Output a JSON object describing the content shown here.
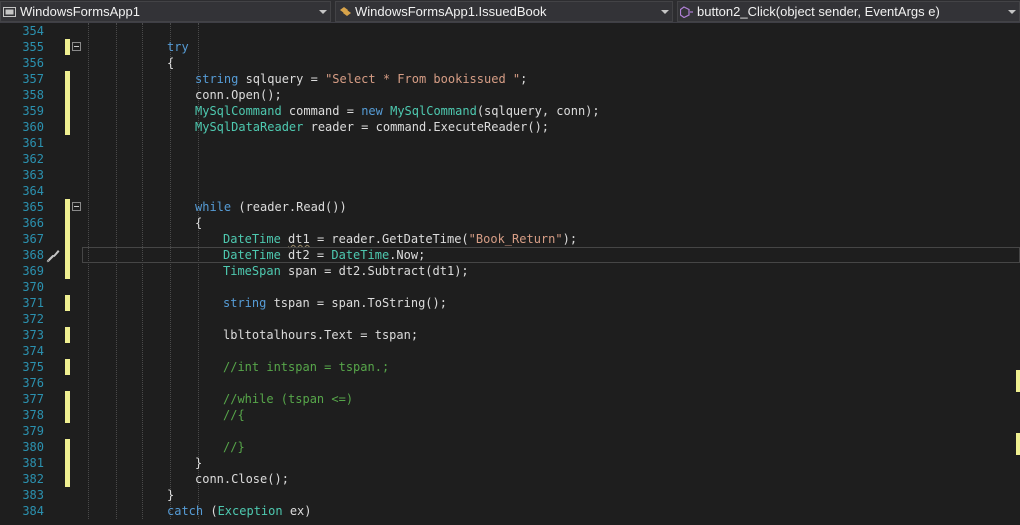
{
  "navbar": {
    "project": "WindowsFormsApp1",
    "class": "WindowsFormsApp1.IssuedBook",
    "member": "button2_Click(object sender, EventArgs e)"
  },
  "colors": {
    "background": "#1e1e1e",
    "line_number": "#2b91af",
    "keyword": "#569cd6",
    "type": "#4ec9b0",
    "string": "#d69d85",
    "comment": "#57a64a",
    "change_marker": "#efef91"
  },
  "editor": {
    "current_line": 368,
    "lines": [
      {
        "n": "354",
        "indent": 0,
        "changed": false,
        "fold": false,
        "tokens": []
      },
      {
        "n": "355",
        "indent": 2,
        "changed": true,
        "fold": true,
        "tokens": [
          {
            "k": "kw",
            "t": "try"
          }
        ]
      },
      {
        "n": "356",
        "indent": 2,
        "changed": false,
        "fold": false,
        "tokens": [
          {
            "k": "p",
            "t": "{"
          }
        ]
      },
      {
        "n": "357",
        "indent": 3,
        "changed": true,
        "fold": false,
        "tokens": [
          {
            "k": "kw",
            "t": "string"
          },
          {
            "k": "p",
            "t": " sqlquery = "
          },
          {
            "k": "str",
            "t": "\"Select * From bookissued \""
          },
          {
            "k": "p",
            "t": ";"
          }
        ]
      },
      {
        "n": "358",
        "indent": 3,
        "changed": true,
        "fold": false,
        "tokens": [
          {
            "k": "p",
            "t": "conn.Open();"
          }
        ]
      },
      {
        "n": "359",
        "indent": 3,
        "changed": true,
        "fold": false,
        "tokens": [
          {
            "k": "ty",
            "t": "MySqlCommand"
          },
          {
            "k": "p",
            "t": " command = "
          },
          {
            "k": "kw",
            "t": "new"
          },
          {
            "k": "p",
            "t": " "
          },
          {
            "k": "ty",
            "t": "MySqlCommand"
          },
          {
            "k": "p",
            "t": "(sqlquery, conn);"
          }
        ]
      },
      {
        "n": "360",
        "indent": 3,
        "changed": true,
        "fold": false,
        "tokens": [
          {
            "k": "ty",
            "t": "MySqlDataReader"
          },
          {
            "k": "p",
            "t": " reader = command.ExecuteReader();"
          }
        ]
      },
      {
        "n": "361",
        "indent": 0,
        "changed": false,
        "fold": false,
        "tokens": []
      },
      {
        "n": "362",
        "indent": 0,
        "changed": false,
        "fold": false,
        "tokens": []
      },
      {
        "n": "363",
        "indent": 0,
        "changed": false,
        "fold": false,
        "tokens": []
      },
      {
        "n": "364",
        "indent": 0,
        "changed": false,
        "fold": false,
        "tokens": []
      },
      {
        "n": "365",
        "indent": 3,
        "changed": true,
        "fold": true,
        "tokens": [
          {
            "k": "kw",
            "t": "while"
          },
          {
            "k": "p",
            "t": " (reader.Read())"
          }
        ]
      },
      {
        "n": "366",
        "indent": 3,
        "changed": true,
        "fold": false,
        "tokens": [
          {
            "k": "p",
            "t": "{"
          }
        ]
      },
      {
        "n": "367",
        "indent": 4,
        "changed": true,
        "fold": false,
        "tokens": [
          {
            "k": "ty",
            "t": "DateTime"
          },
          {
            "k": "p",
            "t": " "
          },
          {
            "k": "sq",
            "t": "dt1"
          },
          {
            "k": "p",
            "t": " = reader.GetDateTime("
          },
          {
            "k": "str",
            "t": "\"Book_Return\""
          },
          {
            "k": "p",
            "t": ");"
          }
        ]
      },
      {
        "n": "368",
        "indent": 4,
        "changed": true,
        "fold": false,
        "tokens": [
          {
            "k": "ty",
            "t": "DateTime"
          },
          {
            "k": "p",
            "t": " dt2 = "
          },
          {
            "k": "ty",
            "t": "DateTime"
          },
          {
            "k": "p",
            "t": ".Now;"
          }
        ]
      },
      {
        "n": "369",
        "indent": 4,
        "changed": true,
        "fold": false,
        "tokens": [
          {
            "k": "ty",
            "t": "TimeSpan"
          },
          {
            "k": "p",
            "t": " span = dt2.Subtract(dt1);"
          }
        ]
      },
      {
        "n": "370",
        "indent": 0,
        "changed": false,
        "fold": false,
        "tokens": []
      },
      {
        "n": "371",
        "indent": 4,
        "changed": true,
        "fold": false,
        "tokens": [
          {
            "k": "kw",
            "t": "string"
          },
          {
            "k": "p",
            "t": " tspan = span.ToString();"
          }
        ]
      },
      {
        "n": "372",
        "indent": 0,
        "changed": false,
        "fold": false,
        "tokens": []
      },
      {
        "n": "373",
        "indent": 4,
        "changed": true,
        "fold": false,
        "tokens": [
          {
            "k": "p",
            "t": "lbltotalhours.Text = tspan;"
          }
        ]
      },
      {
        "n": "374",
        "indent": 0,
        "changed": false,
        "fold": false,
        "tokens": []
      },
      {
        "n": "375",
        "indent": 4,
        "changed": true,
        "fold": false,
        "tokens": [
          {
            "k": "cm",
            "t": "//int intspan = tspan.;"
          }
        ]
      },
      {
        "n": "376",
        "indent": 0,
        "changed": false,
        "fold": false,
        "tokens": []
      },
      {
        "n": "377",
        "indent": 4,
        "changed": true,
        "fold": false,
        "tokens": [
          {
            "k": "cm",
            "t": "//while (tspan <=)"
          }
        ]
      },
      {
        "n": "378",
        "indent": 4,
        "changed": true,
        "fold": false,
        "tokens": [
          {
            "k": "cm",
            "t": "//{"
          }
        ]
      },
      {
        "n": "379",
        "indent": 0,
        "changed": false,
        "fold": false,
        "tokens": []
      },
      {
        "n": "380",
        "indent": 4,
        "changed": true,
        "fold": false,
        "tokens": [
          {
            "k": "cm",
            "t": "//}"
          }
        ]
      },
      {
        "n": "381",
        "indent": 3,
        "changed": true,
        "fold": false,
        "tokens": [
          {
            "k": "p",
            "t": "}"
          }
        ]
      },
      {
        "n": "382",
        "indent": 3,
        "changed": true,
        "fold": false,
        "tokens": [
          {
            "k": "p",
            "t": "conn.Close();"
          }
        ]
      },
      {
        "n": "383",
        "indent": 2,
        "changed": false,
        "fold": false,
        "tokens": [
          {
            "k": "p",
            "t": "}"
          }
        ]
      },
      {
        "n": "384",
        "indent": 2,
        "changed": false,
        "fold": false,
        "tokens": [
          {
            "k": "kw",
            "t": "catch"
          },
          {
            "k": "p",
            "t": " ("
          },
          {
            "k": "ty",
            "t": "Exception"
          },
          {
            "k": "p",
            "t": " ex)"
          }
        ]
      }
    ]
  }
}
